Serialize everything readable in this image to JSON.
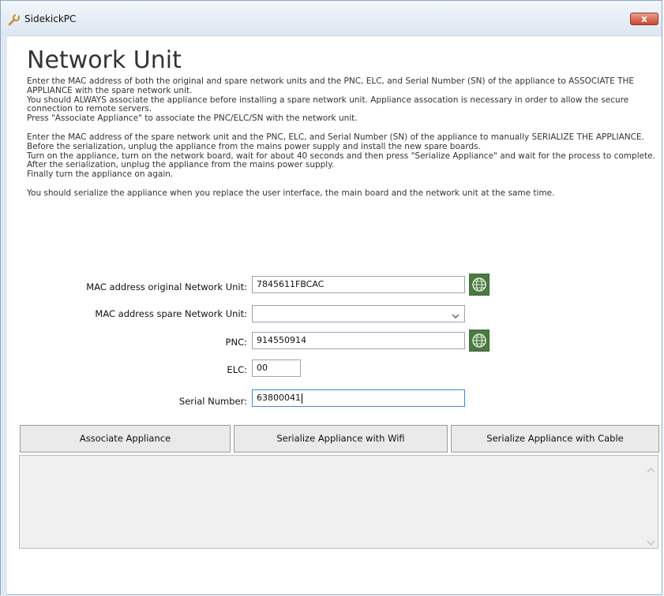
{
  "window": {
    "title": "SidekickPC",
    "close_label": "x"
  },
  "page": {
    "heading": "Network Unit"
  },
  "instructions": {
    "p1": "Enter the MAC address of both the original and spare network units and the PNC, ELC, and Serial Number (SN) of the appliance to ASSOCIATE THE APPLIANCE with the spare network unit.",
    "p2": "You should ALWAYS associate the appliance before installing a spare network unit.  Appliance assocation is necessary in order to allow the secure connection to remote servers.",
    "p3": "Press \"Associate Appliance\" to associate the PNC/ELC/SN with the network unit.",
    "p4": "Enter the MAC address of the spare network unit and the PNC, ELC, and Serial Number (SN) of the appliance to manually SERIALIZE THE APPLIANCE.",
    "p5": "Before the serialization, unplug the appliance from the mains power supply and install the new spare boards.",
    "p6": "Turn on the appliance, turn on the network board, wait for about 40 seconds and then press \"Serialize Appliance\" and wait for the process to complete.",
    "p7": "After the serialization, unplug the appliance from the mains power supply.",
    "p8": "Finally turn the appliance on again.",
    "p9": "You should serialize the appliance when you replace the user interface, the main board and the network unit at the same time."
  },
  "form": {
    "mac_original_label": "MAC address original Network Unit:",
    "mac_original_value": "7845611FBCAC",
    "mac_spare_label": "MAC address spare Network Unit:",
    "mac_spare_value": "",
    "pnc_label": "PNC:",
    "pnc_value": "914550914",
    "elc_label": "ELC:",
    "elc_value": "00",
    "serial_label": "Serial Number:",
    "serial_value": "63800041"
  },
  "buttons": {
    "associate": "Associate Appliance",
    "serialize_wifi": "Serialize Appliance with Wifi",
    "serialize_cable": "Serialize Appliance with Cable"
  },
  "output": {
    "text": ""
  },
  "icons": {
    "title": "wrench-icon",
    "globe": "globe-icon",
    "dropdown": "chevron-down-icon"
  },
  "colors": {
    "globe_button": "#4a7a3f",
    "close_button": "#c9452d",
    "active_border": "#3b8bd6"
  }
}
